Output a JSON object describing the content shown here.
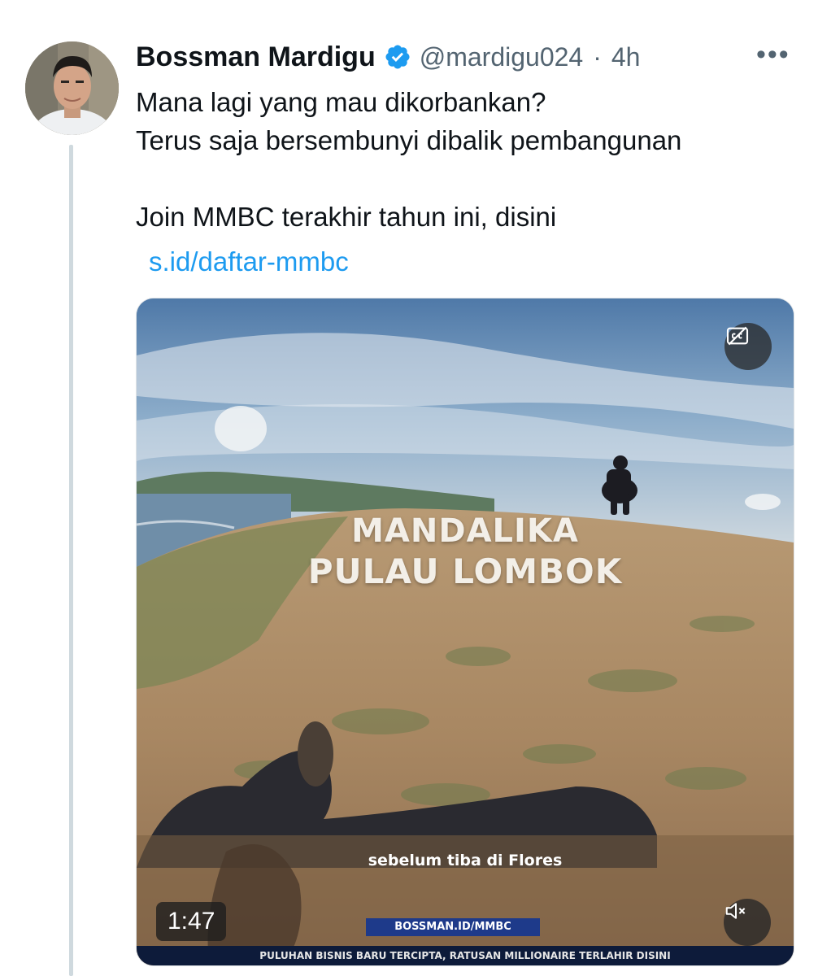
{
  "tweet": {
    "author": {
      "name": "Bossman Mardigu",
      "handle": "@mardigu024",
      "separator": "·",
      "time": "4h",
      "verified": true,
      "avatar_icon": "avatar-photo"
    },
    "more_label": "•••",
    "text_lines": [
      "Mana lagi yang mau dikorbankan?",
      "Terus saja bersembunyi dibalik pembangunan",
      "Join MMBC terakhir tahun ini, disini"
    ],
    "link": "s.id/daftar-mmbc",
    "colors": {
      "link": "#1d9bf0",
      "verified": "#1d9bf0",
      "secondary_text": "#536471"
    }
  },
  "video": {
    "overlay_line1": "MANDALIKA",
    "overlay_line2": "PULAU LOMBOK",
    "caption": "sebelum tiba di Flores",
    "banner": "BOSSMAN.ID/MMBC",
    "ticker": "PULUHAN BISNIS BARU TERCIPTA, RATUSAN MILLIONAIRE TERLAHIR DISINI",
    "duration": "1:47",
    "cc_icon": "closed-captions-off-icon",
    "mute_icon": "volume-muted-icon"
  }
}
